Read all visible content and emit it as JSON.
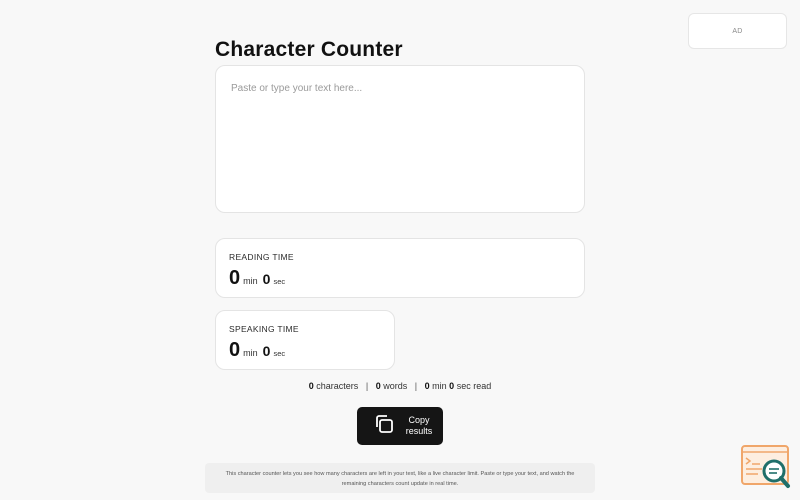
{
  "ad": {
    "label": "AD"
  },
  "page": {
    "title": "Character Counter"
  },
  "editor": {
    "placeholder": "Paste or type your text here..."
  },
  "reading_time": {
    "label": "READING TIME",
    "minutes": "0",
    "min_unit": "min",
    "seconds": "0",
    "sec_unit": "sec"
  },
  "speaking_time": {
    "label": "SPEAKING TIME",
    "minutes": "0",
    "min_unit": "min",
    "seconds": "0",
    "sec_unit": "sec"
  },
  "stats": {
    "characters_count": "0",
    "characters_label": "characters",
    "words_count": "0",
    "words_label": "words",
    "read_min": "0",
    "min_label": "min",
    "read_sec": "0",
    "sec_read_label": "sec read",
    "separator": "|"
  },
  "copy_button": {
    "line1": "Copy",
    "line2": "results"
  },
  "footer": {
    "line1": "This character counter lets you see how many characters are left in your text, like a live character limit. Paste or type your text, and watch the",
    "line2": "remaining characters count update in real time."
  },
  "colors": {
    "background": "#f8f8f8",
    "button": "#151515",
    "logo_orange": "#f0a66a",
    "logo_teal": "#1f6f6a"
  },
  "icons": {
    "copy": "copy-icon",
    "logo": "search-code-logo-icon"
  }
}
